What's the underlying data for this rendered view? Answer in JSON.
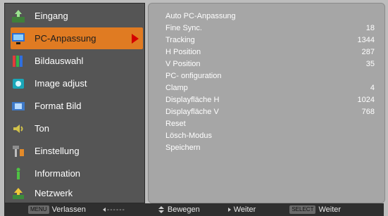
{
  "sidebar": {
    "items": [
      {
        "label": "Eingang",
        "icon": "input-icon"
      },
      {
        "label": "PC-Anpassung",
        "icon": "pc-adjust-icon",
        "selected": true
      },
      {
        "label": "Bildauswahl",
        "icon": "image-select-icon"
      },
      {
        "label": "Image adjust",
        "icon": "image-adjust-icon"
      },
      {
        "label": "Format Bild",
        "icon": "screen-format-icon"
      },
      {
        "label": "Ton",
        "icon": "sound-icon"
      },
      {
        "label": "Einstellung",
        "icon": "setting-icon"
      },
      {
        "label": "Information",
        "icon": "information-icon"
      },
      {
        "label": "Netzwerk",
        "icon": "network-icon"
      }
    ]
  },
  "panel": {
    "rows": [
      {
        "label": "Auto PC-Anpassung",
        "value": ""
      },
      {
        "label": "Fine Sync.",
        "value": "18"
      },
      {
        "label": "Tracking",
        "value": "1344"
      },
      {
        "label": "H Position",
        "value": "287"
      },
      {
        "label": "V Position",
        "value": "35"
      },
      {
        "label": "PC-  onfiguration",
        "value": ""
      },
      {
        "label": "Clamp",
        "value": "4"
      },
      {
        "label": "Displayfläche H",
        "value": "1024"
      },
      {
        "label": "Displayfläche V",
        "value": "768"
      },
      {
        "label": "Reset",
        "value": ""
      },
      {
        "label": "Lösch-Modus",
        "value": ""
      },
      {
        "label": "Speichern",
        "value": ""
      }
    ]
  },
  "footer": {
    "menu_badge": "MENU",
    "back_label": "Verlassen",
    "move_label": "Bewegen",
    "next_label": "Weiter",
    "select_badge": "SELECT",
    "select_label": "Weiter"
  },
  "colors": {
    "accent": "#e07b22",
    "arrow": "#d40000",
    "panel": "#a6a6a6",
    "sidebar": "#555555"
  }
}
